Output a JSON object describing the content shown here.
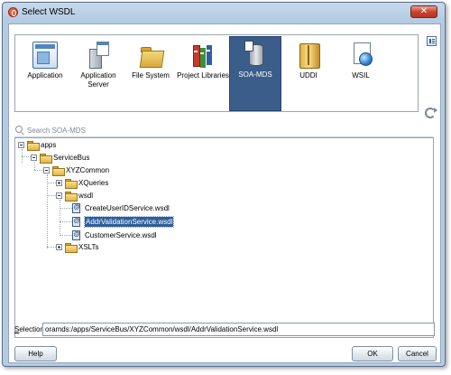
{
  "window": {
    "title": "Select WSDL",
    "close_glyph": "✕"
  },
  "sources": [
    {
      "label": "Application",
      "icon": "application-icon",
      "selected": false
    },
    {
      "label": "Application Server",
      "icon": "application-server-icon",
      "selected": false
    },
    {
      "label": "File System",
      "icon": "file-system-icon",
      "selected": false
    },
    {
      "label": "Project Libraries",
      "icon": "project-libraries-icon",
      "selected": false
    },
    {
      "label": "SOA-MDS",
      "icon": "soa-mds-icon",
      "selected": true
    },
    {
      "label": "UDDI",
      "icon": "uddi-icon",
      "selected": false
    },
    {
      "label": "WSIL",
      "icon": "wsil-icon",
      "selected": false
    }
  ],
  "search": {
    "placeholder": "Search SOA-MDS",
    "value": ""
  },
  "tree": [
    {
      "label": "apps",
      "type": "folder",
      "expanded": true,
      "level": 0
    },
    {
      "label": "ServiceBus",
      "type": "folder",
      "expanded": true,
      "level": 1
    },
    {
      "label": "XYZCommon",
      "type": "folder",
      "expanded": true,
      "level": 2
    },
    {
      "label": "XQueries",
      "type": "folder",
      "expanded": false,
      "level": 3
    },
    {
      "label": "wsdl",
      "type": "folder",
      "expanded": true,
      "level": 3
    },
    {
      "label": "CreateUserIDService.wsdl",
      "type": "wsdl-file",
      "level": 4,
      "selected": false
    },
    {
      "label": "AddrValidationService.wsdl",
      "type": "wsdl-file",
      "level": 4,
      "selected": true
    },
    {
      "label": "CustomerService.wsdl",
      "type": "wsdl-file",
      "level": 4,
      "selected": false
    },
    {
      "label": "XSLTs",
      "type": "folder",
      "expanded": false,
      "level": 3
    }
  ],
  "selection": {
    "label_prefix": "S",
    "label_rest": "election:",
    "value": "oramds:/apps/ServiceBus/XYZCommon/wsdl/AddrValidationService.wsdl"
  },
  "buttons": {
    "help": "Help",
    "ok": "OK",
    "cancel": "Cancel"
  },
  "colors": {
    "selection_highlight": "#2f5d9a",
    "source_selected": "#3a5d8a",
    "title_bar": "#b4cbe3",
    "close_button": "#c9442e"
  }
}
